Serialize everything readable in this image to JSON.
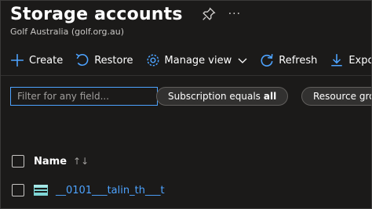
{
  "page": {
    "title": "Storage accounts",
    "subtitle": "Golf Australia (golf.org.au)",
    "more_label": "···"
  },
  "toolbar": {
    "create_label": "Create",
    "restore_label": "Restore",
    "manage_view_label": "Manage view",
    "refresh_label": "Refresh",
    "export_label": "Expo"
  },
  "filters": {
    "search_placeholder": "Filter for any field...",
    "subscription_pill_prefix": "Subscription equals",
    "subscription_pill_value": "all",
    "resource_group_pill_label": "Resource gro"
  },
  "grid": {
    "column_name_label": "Name",
    "sort_indicator": "↑↓",
    "rows": [
      {
        "name": "__0101___talin_th___t"
      }
    ]
  },
  "colors": {
    "background": "#1b1a19",
    "accent": "#4da3ff",
    "pill_bg": "#323130"
  }
}
